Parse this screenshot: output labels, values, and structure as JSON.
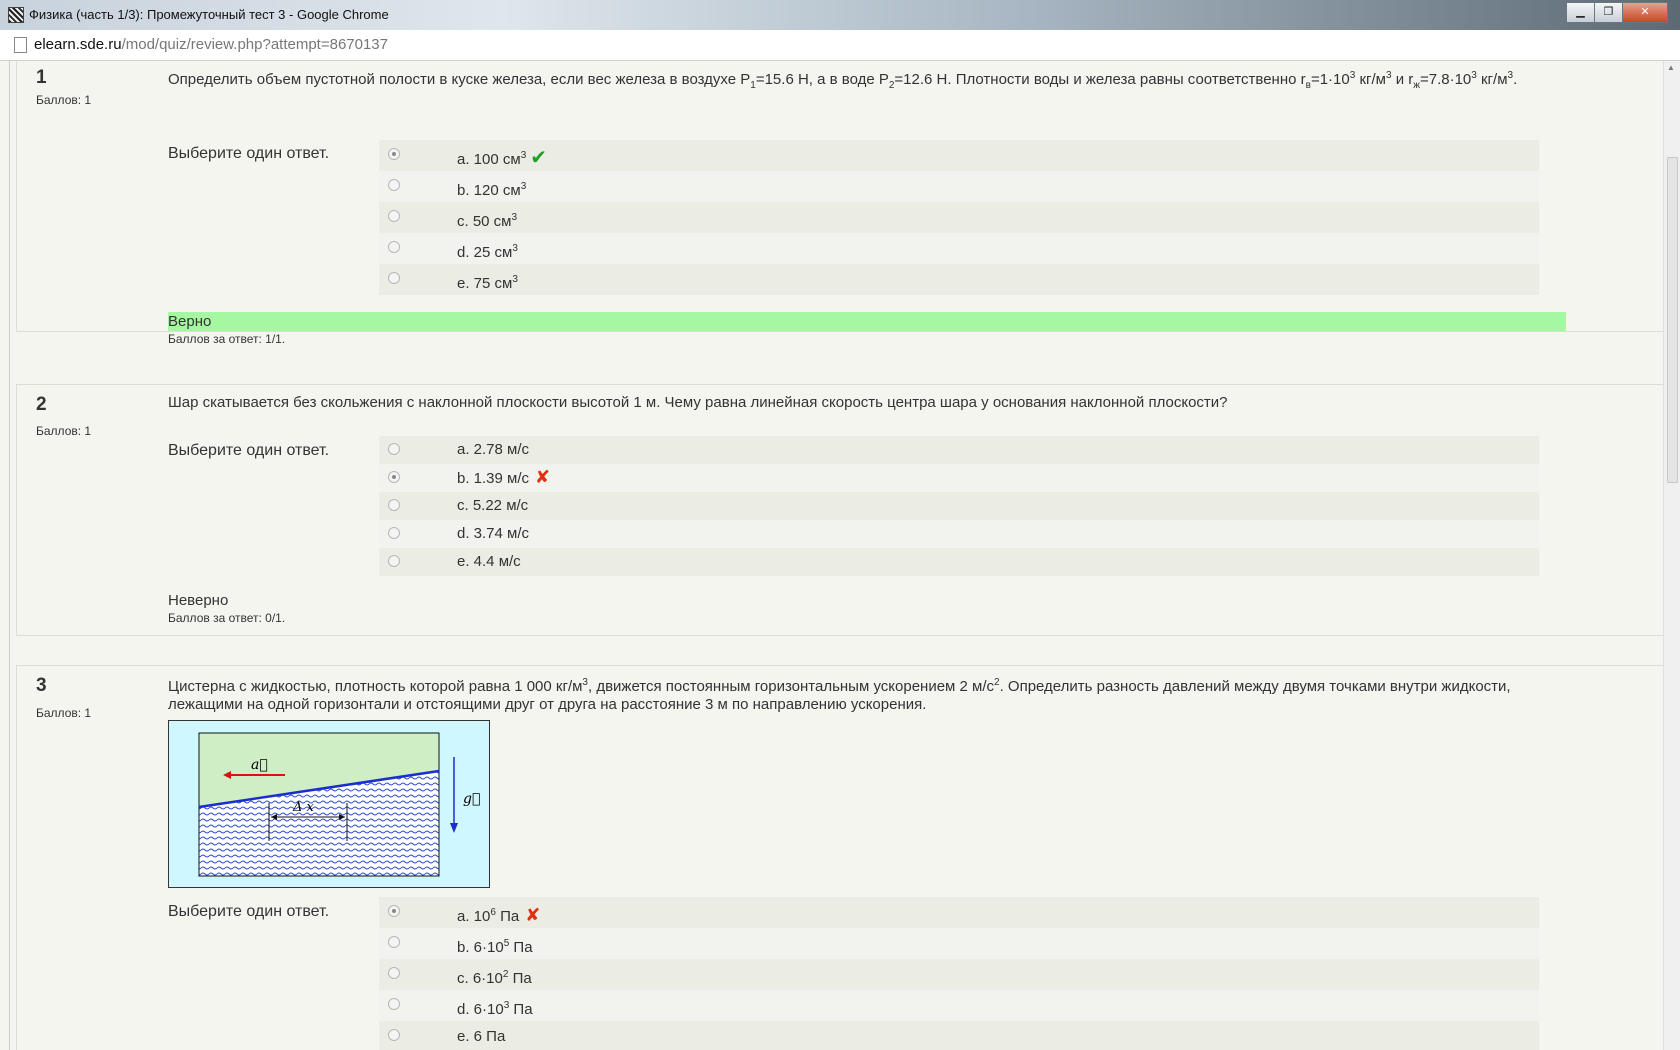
{
  "window": {
    "title": "Физика (часть 1/3): Промежуточный тест 3 - Google Chrome",
    "btn_min": "▁",
    "btn_max": "❐",
    "btn_close": "✕"
  },
  "address": {
    "host": "elearn.sde.ru",
    "path": "/mod/quiz/review.php?attempt=8670137"
  },
  "prompt_label": "Выберите один ответ.",
  "questions": [
    {
      "number": "1",
      "marks": "Баллов: 1",
      "text_a": "Определить объем пустотной полости в куске железа, если вес железа в воздухе P",
      "sub1": "1",
      "text_b": "=15.6 Н, а в воде P",
      "sub2": "2",
      "text_c": "=12.6 Н. Плотности воды и железа равны соответственно r",
      "sub3": "в",
      "text_d": "=1·10",
      "sup1": "3",
      "text_e": " кг/м",
      "sup2": "3",
      "text_f": " и r",
      "sub4": "ж",
      "text_g": "=7.8·10",
      "sup3": "3",
      "text_h": " кг/м",
      "sup4": "3",
      "text_i": ".",
      "options": [
        {
          "label": "a. 100 см",
          "sup": "3",
          "mark": "✔"
        },
        {
          "label": "b. 120 см",
          "sup": "3"
        },
        {
          "label": "c. 50 см",
          "sup": "3"
        },
        {
          "label": "d. 25 см",
          "sup": "3"
        },
        {
          "label": "e. 75 см",
          "sup": "3"
        }
      ],
      "feedback": "Верно",
      "grade": "Баллов за ответ: 1/1."
    },
    {
      "number": "2",
      "marks": "Баллов: 1",
      "text": "Шар скатывается без скольжения с наклонной плоскости высотой 1 м. Чему равна линейная скорость центра шара у основания наклонной плоскости?",
      "options": [
        {
          "label": "a. 2.78 м/с"
        },
        {
          "label": "b. 1.39 м/с",
          "mark": "✘"
        },
        {
          "label": "c. 5.22 м/с"
        },
        {
          "label": "d. 3.74 м/с"
        },
        {
          "label": "e. 4.4 м/с"
        }
      ],
      "feedback": "Неверно",
      "grade": "Баллов за ответ: 0/1."
    },
    {
      "number": "3",
      "marks": "Баллов: 1",
      "text_a": "Цистерна с жидкостью, плотность которой равна 1 000 кг/м",
      "sup1": "3",
      "text_b": ", движется постоянным горизонтальным ускорением 2 м/с",
      "sup2": "2",
      "text_c": ". Определить разность давлений между двумя точками внутри жидкости, лежащими на одной горизонтали и отстоящими друг от друга на расстояние 3 м по направлению ускорения.",
      "figure": {
        "label_a": "a⃗",
        "label_g": "g⃗",
        "label_dx": "Δ x"
      },
      "options": [
        {
          "label": "a. 10",
          "sup": "6",
          "tail": " Па",
          "mark": "✘"
        },
        {
          "label": "b. 6·10",
          "sup": "5",
          "tail": " Па"
        },
        {
          "label": "c. 6·10",
          "sup": "2",
          "tail": " Па"
        },
        {
          "label": "d. 6·10",
          "sup": "3",
          "tail": " Па"
        },
        {
          "label": "e. 6 Па"
        }
      ]
    }
  ]
}
